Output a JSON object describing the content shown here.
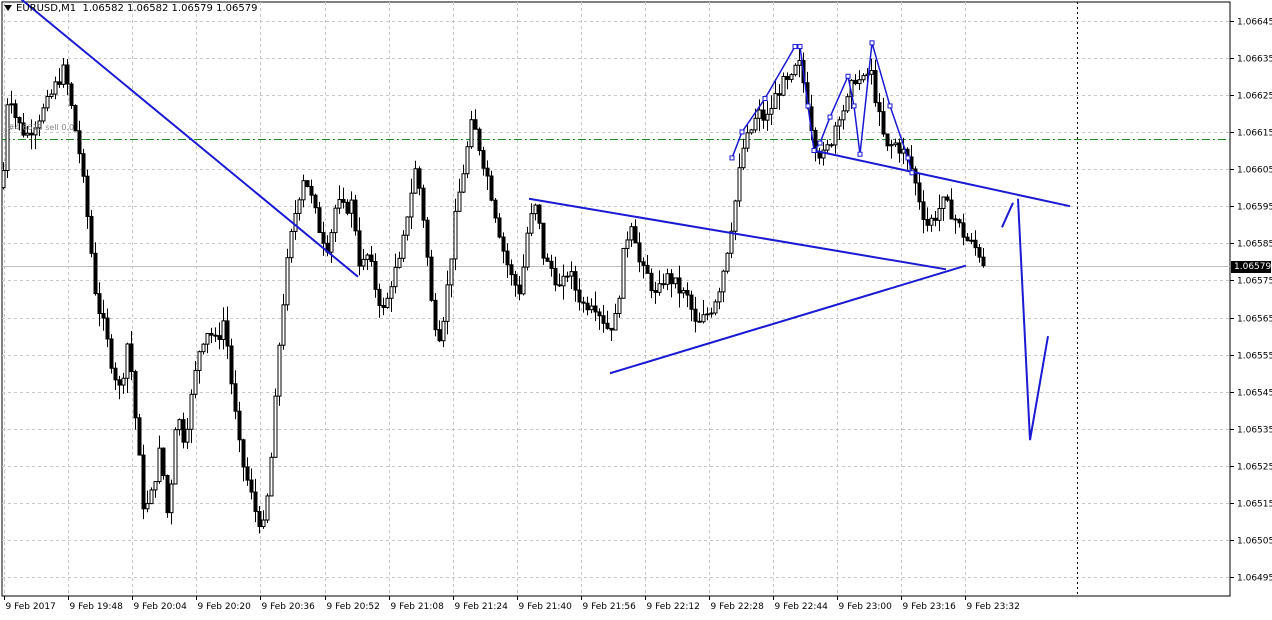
{
  "header": {
    "symbol": "EURUSD,M1",
    "quote": "1.06582 1.06582 1.06579 1.06579"
  },
  "level_label": "#4 6613 sell 0.0",
  "current_price": "1.06579",
  "colors": {
    "background": "#ffffff",
    "grid": "#c8c8c8",
    "candles": "#000000",
    "trendlines": "#1a1ad2",
    "level_line": "#1f8a1f"
  },
  "chart_data": {
    "type": "candlestick",
    "symbol": "EURUSD",
    "timeframe": "M1",
    "ylim": [
      1.0649,
      1.0665
    ],
    "y_ticks": [
      "1.06645",
      "1.06635",
      "1.06625",
      "1.06615",
      "1.06605",
      "1.06595",
      "1.06585",
      "1.06575",
      "1.06565",
      "1.06555",
      "1.06545",
      "1.06535",
      "1.06525",
      "1.06515",
      "1.06505",
      "1.06495"
    ],
    "x_ticks": [
      "9 Feb 2017",
      "9 Feb 19:48",
      "9 Feb 20:04",
      "9 Feb 20:20",
      "9 Feb 20:36",
      "9 Feb 20:52",
      "9 Feb 21:08",
      "9 Feb 21:24",
      "9 Feb 21:40",
      "9 Feb 21:56",
      "9 Feb 22:12",
      "9 Feb 22:28",
      "9 Feb 22:44",
      "9 Feb 23:00",
      "9 Feb 23:16",
      "9 Feb 23:32"
    ],
    "grid": true,
    "horizontal_level": 1.06613,
    "current_price": 1.06579,
    "close_path": [
      [
        0,
        1.066
      ],
      [
        6,
        1.06628
      ],
      [
        14,
        1.06618
      ],
      [
        24,
        1.06614
      ],
      [
        34,
        1.06618
      ],
      [
        44,
        1.06622
      ],
      [
        54,
        1.06628
      ],
      [
        62,
        1.06632
      ],
      [
        70,
        1.0662
      ],
      [
        78,
        1.06608
      ],
      [
        86,
        1.0659
      ],
      [
        94,
        1.0657
      ],
      [
        102,
        1.06562
      ],
      [
        110,
        1.06552
      ],
      [
        118,
        1.06545
      ],
      [
        126,
        1.0656
      ],
      [
        134,
        1.06535
      ],
      [
        142,
        1.06512
      ],
      [
        150,
        1.06518
      ],
      [
        158,
        1.0653
      ],
      [
        166,
        1.0651
      ],
      [
        174,
        1.0654
      ],
      [
        182,
        1.06532
      ],
      [
        190,
        1.06545
      ],
      [
        198,
        1.06558
      ],
      [
        206,
        1.06562
      ],
      [
        214,
        1.06558
      ],
      [
        222,
        1.06565
      ],
      [
        230,
        1.06545
      ],
      [
        238,
        1.06528
      ],
      [
        246,
        1.0652
      ],
      [
        254,
        1.06512
      ],
      [
        262,
        1.06508
      ],
      [
        270,
        1.0653
      ],
      [
        278,
        1.06562
      ],
      [
        286,
        1.06582
      ],
      [
        294,
        1.06595
      ],
      [
        302,
        1.06604
      ],
      [
        310,
        1.06596
      ],
      [
        318,
        1.06588
      ],
      [
        326,
        1.06584
      ],
      [
        334,
        1.06596
      ],
      [
        342,
        1.06594
      ],
      [
        350,
        1.06596
      ],
      [
        358,
        1.06578
      ],
      [
        366,
        1.06582
      ],
      [
        374,
        1.06572
      ],
      [
        382,
        1.06566
      ],
      [
        390,
        1.06576
      ],
      [
        398,
        1.0658
      ],
      [
        406,
        1.06595
      ],
      [
        414,
        1.06606
      ],
      [
        422,
        1.0659
      ],
      [
        430,
        1.06566
      ],
      [
        438,
        1.0656
      ],
      [
        446,
        1.06575
      ],
      [
        454,
        1.06594
      ],
      [
        462,
        1.06606
      ],
      [
        470,
        1.06618
      ],
      [
        478,
        1.0661
      ],
      [
        486,
        1.06602
      ],
      [
        494,
        1.06592
      ],
      [
        502,
        1.06582
      ],
      [
        510,
        1.06575
      ],
      [
        518,
        1.06572
      ],
      [
        526,
        1.0659
      ],
      [
        534,
        1.06595
      ],
      [
        542,
        1.0658
      ],
      [
        550,
        1.06578
      ],
      [
        558,
        1.06572
      ],
      [
        566,
        1.06578
      ],
      [
        574,
        1.06572
      ],
      [
        582,
        1.06568
      ],
      [
        590,
        1.0657
      ],
      [
        598,
        1.06566
      ],
      [
        606,
        1.06562
      ],
      [
        614,
        1.06565
      ],
      [
        622,
        1.06584
      ],
      [
        630,
        1.06592
      ],
      [
        638,
        1.06578
      ],
      [
        646,
        1.06576
      ],
      [
        654,
        1.0657
      ],
      [
        662,
        1.06576
      ],
      [
        670,
        1.06575
      ],
      [
        678,
        1.06572
      ],
      [
        686,
        1.0657
      ],
      [
        694,
        1.06562
      ],
      [
        702,
        1.06565
      ],
      [
        710,
        1.06568
      ],
      [
        718,
        1.06574
      ],
      [
        726,
        1.06585
      ],
      [
        734,
        1.06598
      ],
      [
        740,
        1.0661
      ],
      [
        748,
        1.06615
      ],
      [
        756,
        1.0662
      ],
      [
        764,
        1.06618
      ],
      [
        772,
        1.06624
      ],
      [
        780,
        1.06628
      ],
      [
        788,
        1.06628
      ],
      [
        796,
        1.06634
      ],
      [
        804,
        1.06625
      ],
      [
        812,
        1.06612
      ],
      [
        820,
        1.06608
      ],
      [
        828,
        1.06612
      ],
      [
        836,
        1.0662
      ],
      [
        844,
        1.06622
      ],
      [
        852,
        1.0663
      ],
      [
        860,
        1.06628
      ],
      [
        868,
        1.06632
      ],
      [
        876,
        1.0662
      ],
      [
        884,
        1.0661
      ],
      [
        892,
        1.06612
      ],
      [
        900,
        1.0661
      ],
      [
        908,
        1.06606
      ],
      [
        916,
        1.06598
      ],
      [
        924,
        1.0659
      ],
      [
        932,
        1.06592
      ],
      [
        940,
        1.06596
      ],
      [
        948,
        1.06594
      ],
      [
        956,
        1.0659
      ],
      [
        964,
        1.06586
      ],
      [
        972,
        1.06584
      ],
      [
        978,
        1.06582
      ],
      [
        984,
        1.06579
      ]
    ],
    "trendlines": [
      {
        "from": [
          0,
          1.06655
        ],
        "to": [
          356,
          1.06576
        ]
      },
      {
        "from": [
          527,
          1.06597
        ],
        "to": [
          944,
          1.06578
        ]
      },
      {
        "from": [
          608,
          1.0655
        ],
        "to": [
          964,
          1.06579
        ]
      },
      {
        "from": [
          812,
          1.0661
        ],
        "to": [
          1068,
          1.06595
        ]
      }
    ],
    "zigzag_points": [
      [
        730,
        1.06608
      ],
      [
        740,
        1.06615
      ],
      [
        763,
        1.06624
      ],
      [
        793,
        1.06638
      ],
      [
        798,
        1.06638
      ],
      [
        806,
        1.06622
      ],
      [
        812,
        1.0661
      ],
      [
        818,
        1.06612
      ],
      [
        828,
        1.06619
      ],
      [
        846,
        1.0663
      ],
      [
        852,
        1.06622
      ],
      [
        858,
        1.06609
      ],
      [
        870,
        1.06639
      ],
      [
        888,
        1.06622
      ],
      [
        906,
        1.06608
      ],
      [
        910,
        1.06604
      ]
    ],
    "projection": [
      [
        1000,
        1.06592
      ],
      [
        1016,
        1.06597
      ],
      [
        1028,
        1.06532
      ],
      [
        1046,
        1.0656
      ]
    ],
    "period_separator_x": 1075
  }
}
